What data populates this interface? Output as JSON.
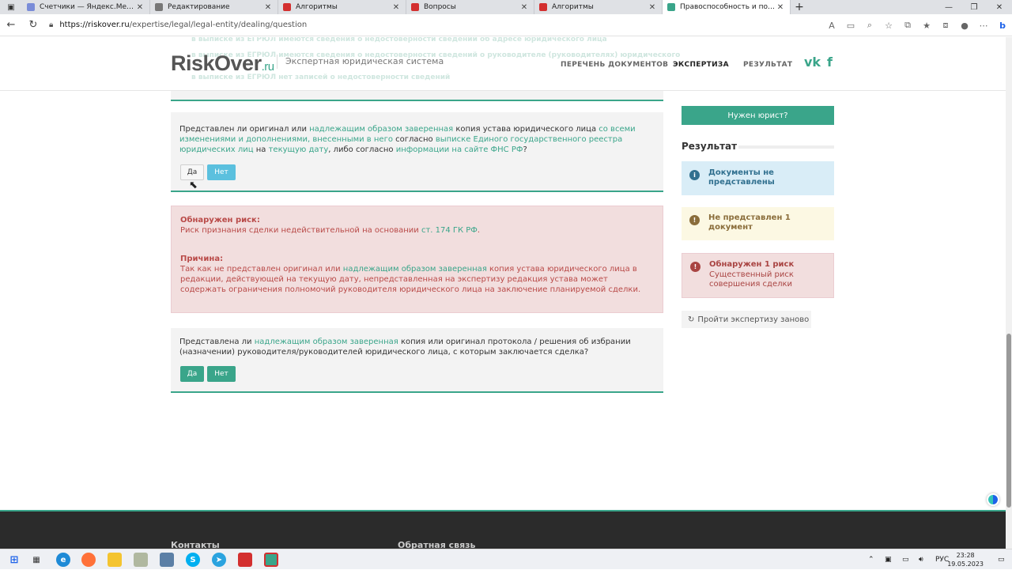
{
  "browser": {
    "tabs": [
      {
        "title": "Счетчики — Яндекс.Метрика",
        "favicon_color": "#7a8cd8",
        "active": false
      },
      {
        "title": "Редактирование",
        "favicon_color": "#777777",
        "active": false
      },
      {
        "title": "Алгоритмы",
        "favicon_color": "#d32f2f",
        "active": false
      },
      {
        "title": "Вопросы",
        "favicon_color": "#d32f2f",
        "active": false
      },
      {
        "title": "Алгоритмы",
        "favicon_color": "#d32f2f",
        "active": false
      },
      {
        "title": "Правоспособность и полномо...",
        "favicon_color": "#3aa58a",
        "active": true
      }
    ],
    "url_domain": "https://riskover.ru",
    "url_path": "/expertise/legal/legal-entity/dealing/question"
  },
  "header": {
    "ghost_line_1": "в выписке из ЕГРЮЛ имеются сведения о недостоверности сведений об адресе юридического лица",
    "ghost_line_2": "в выписке из ЕГРЮЛ имеются сведения о недостоверности сведений о руководителе (руководителях) юридического",
    "ghost_line_3": "в выписке из ЕГРЮЛ нет записей о недостоверности сведений",
    "logo_main": "RiskOver",
    "logo_tld": ".ru",
    "tagline": "Экспертная юридическая система",
    "nav": {
      "documents": "ПЕРЕЧЕНЬ ДОКУМЕНТОВ",
      "expertise": "ЭКСПЕРТИЗА",
      "result": "РЕЗУЛЬТАТ"
    },
    "social_vk": "vk",
    "social_fb": "f"
  },
  "question1": {
    "t1": "Представлен ли оригинал или ",
    "l1": "надлежащим образом заверенная",
    "t2": " копия устава юридического лица ",
    "l2": "со всеми изменениями и дополнениями, внесенными в него",
    "t3": " согласно ",
    "l3": "выписке Единого государственного реестра юридических лиц",
    "t4": " на ",
    "l4": "текущую дату",
    "t5": ", либо согласно ",
    "l5": "информации на сайте ФНС РФ",
    "t6": "?",
    "yes": "Да",
    "no": "Нет"
  },
  "risk": {
    "heading": "Обнаружен риск:",
    "text": "Риск признания сделки недействительной на основании ",
    "link": "ст. 174 ГК РФ",
    "text_end": ".",
    "reason_heading": "Причина:",
    "r1": "Так как не представлен оригинал или ",
    "rl": "надлежащим образом заверенная",
    "r2": " копия устава юридического лица в редакции, действующей на текущую дату, непредставленная на экспертизу редакция устава может содержать ограничения полномочий руководителя юридического лица на заключение планируемой сделки."
  },
  "question2": {
    "t1": "Представлена ли ",
    "l1": "надлежащим образом заверенная",
    "t2": " копия или оригинал протокола / решения об избрании (назначении) руководителя/руководителей юридического лица, с которым заключается сделка?",
    "yes": "Да",
    "no": "Нет"
  },
  "sidebar": {
    "lawyer_button": "Нужен юрист?",
    "result_title": "Результат",
    "status_info": "Документы не представлены",
    "status_warn": "Не представлен 1 документ",
    "status_risk_title": "Обнаружен 1 риск",
    "status_risk_text": "Существенный риск совершения сделки",
    "restart": "Пройти экспертизу заново"
  },
  "footer": {
    "contacts": "Контакты",
    "feedback": "Обратная связь"
  },
  "taskbar": {
    "lang": "РУС",
    "time": "23:28",
    "date": "19.05.2023"
  },
  "colors": {
    "accent": "#3aa58a",
    "info_bg": "#d9edf7",
    "warn_bg": "#fcf8e3",
    "danger_bg": "#f2dede"
  }
}
